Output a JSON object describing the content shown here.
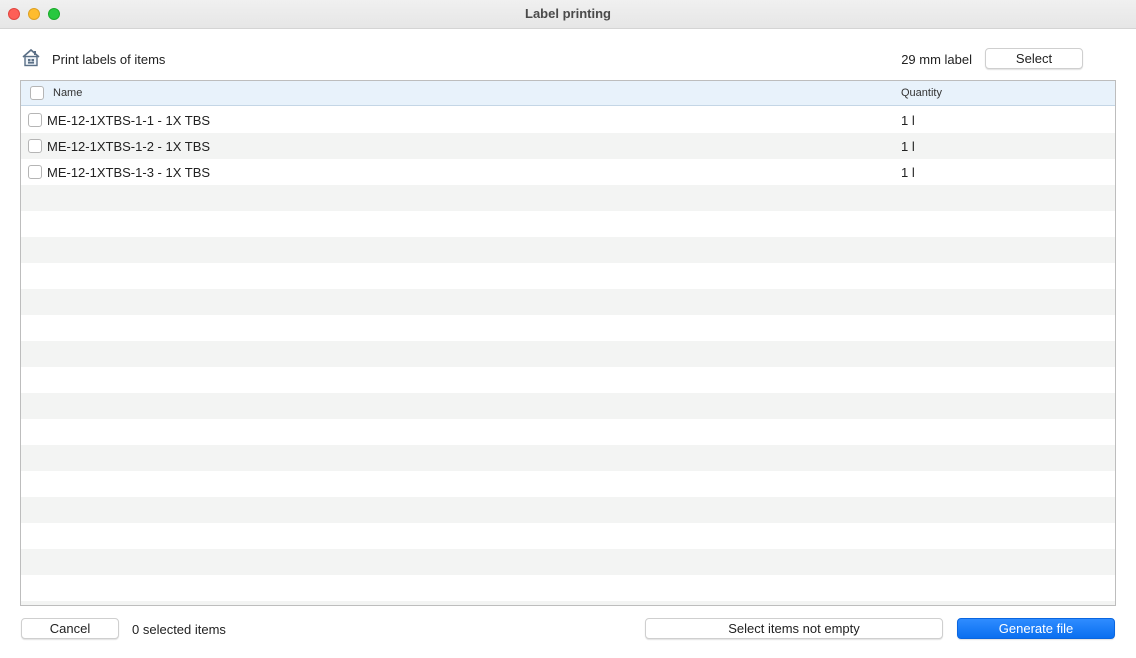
{
  "window": {
    "title": "Label printing"
  },
  "header": {
    "label": "Print labels of items",
    "label_size": "29 mm label",
    "select_label": "Select"
  },
  "table": {
    "columns": {
      "name": "Name",
      "quantity": "Quantity"
    },
    "rows": [
      {
        "name": "ME-12-1XTBS-1-1 - 1X TBS",
        "quantity": "1 l"
      },
      {
        "name": "ME-12-1XTBS-1-2 - 1X TBS",
        "quantity": "1 l"
      },
      {
        "name": "ME-12-1XTBS-1-3 - 1X TBS",
        "quantity": "1 l"
      }
    ]
  },
  "footer": {
    "cancel_label": "Cancel",
    "selected_count": "0 selected items",
    "select_not_empty_label": "Select items not empty",
    "generate_label": "Generate file"
  },
  "icons": {
    "header": "house-icon"
  },
  "colors": {
    "primary": "#0a6ff0",
    "header_bg": "#e8f2fb",
    "row_alt": "#f3f4f3"
  }
}
